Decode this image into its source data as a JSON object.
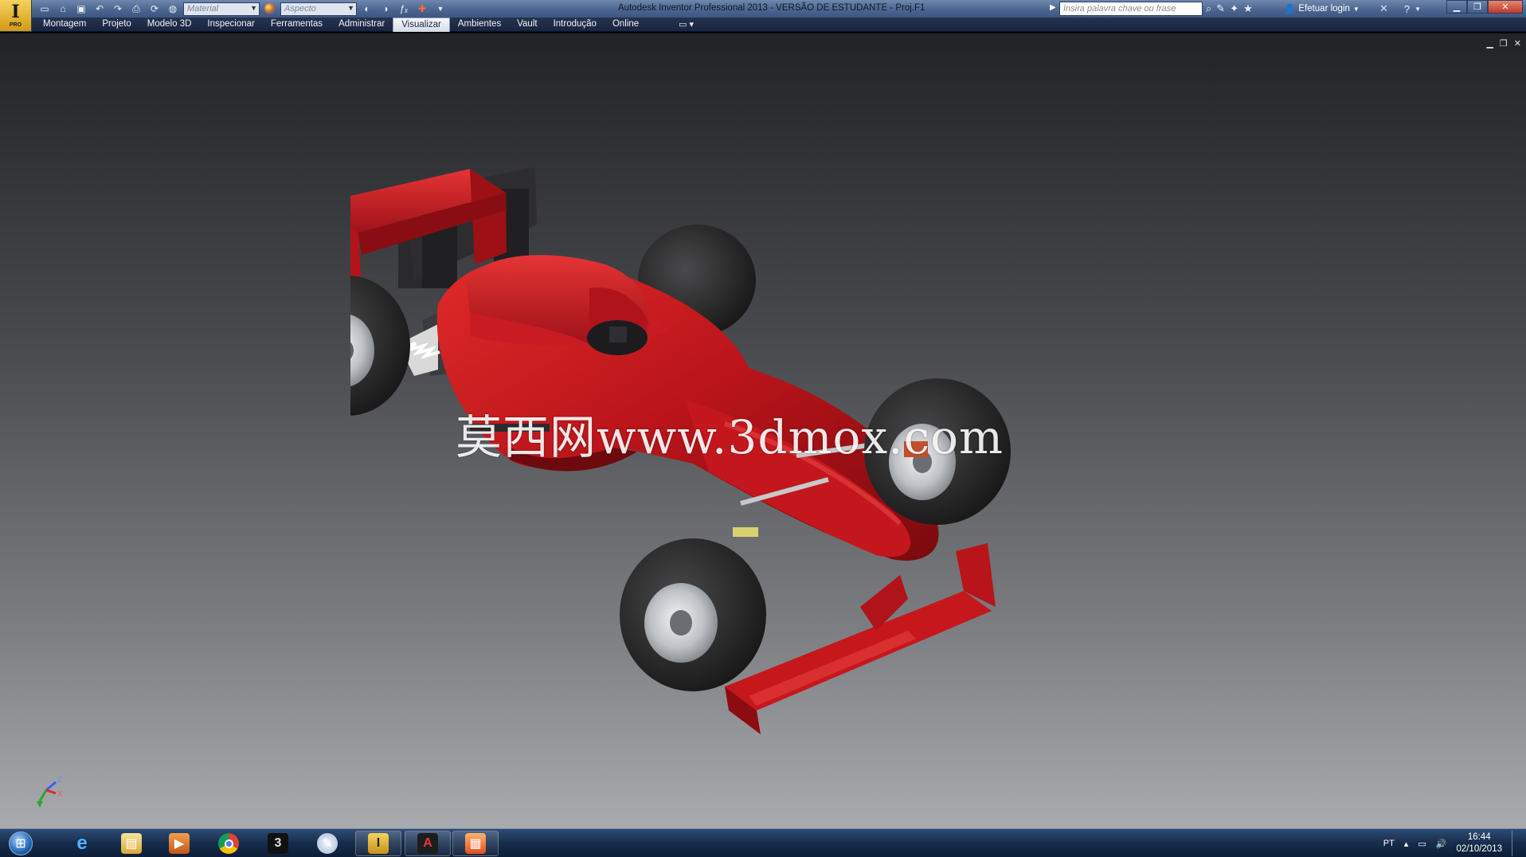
{
  "app": {
    "title": "Autodesk Inventor Professional 2013 - VERSÃO DE ESTUDANTE - Proj.F1",
    "logo_badge": "PRO"
  },
  "toolbar": {
    "material_placeholder": "Material",
    "appearance_placeholder": "Aspecto",
    "search_placeholder": "Insira palavra chave ou frase",
    "login_label": "Efetuar login"
  },
  "ribbon": {
    "tabs": [
      {
        "label": "Montagem",
        "active": false
      },
      {
        "label": "Projeto",
        "active": false
      },
      {
        "label": "Modelo 3D",
        "active": false
      },
      {
        "label": "Inspecionar",
        "active": false
      },
      {
        "label": "Ferramentas",
        "active": false
      },
      {
        "label": "Administrar",
        "active": false
      },
      {
        "label": "Visualizar",
        "active": true
      },
      {
        "label": "Ambientes",
        "active": false
      },
      {
        "label": "Vault",
        "active": false
      },
      {
        "label": "Introdução",
        "active": false
      },
      {
        "label": "Online",
        "active": false
      }
    ]
  },
  "viewport": {
    "watermark": "莫西网www.3dmox.com",
    "triad_labels": {
      "z": "Z",
      "x": "X",
      "y": "Y"
    },
    "model_color": "#c8161a"
  },
  "taskbar": {
    "apps": [
      {
        "name": "internet-explorer",
        "open": false
      },
      {
        "name": "file-explorer",
        "open": false
      },
      {
        "name": "media-player",
        "open": false
      },
      {
        "name": "chrome",
        "open": false
      },
      {
        "name": "3ds-max",
        "open": false
      },
      {
        "name": "paint-app",
        "open": false
      },
      {
        "name": "inventor",
        "open": true
      },
      {
        "name": "autocad",
        "open": true
      },
      {
        "name": "office-app",
        "open": true
      }
    ],
    "language": "PT",
    "time": "16:44",
    "date": "02/10/2013"
  }
}
